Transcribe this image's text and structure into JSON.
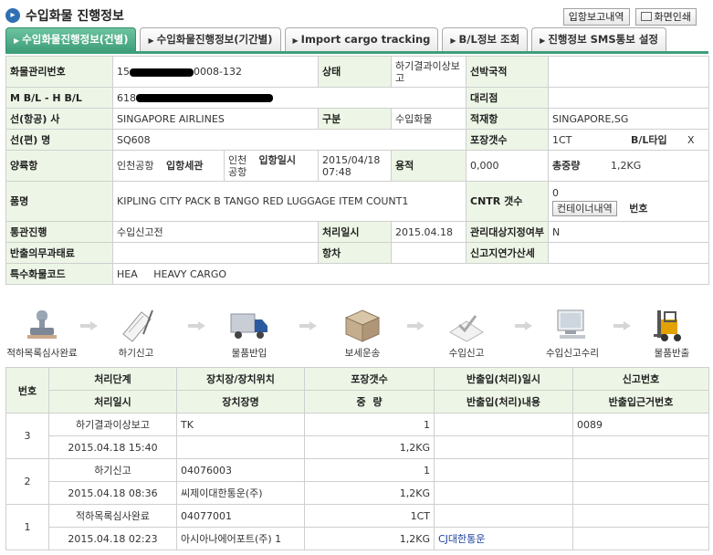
{
  "title": "수입화물 진행정보",
  "top_buttons": {
    "entry_report": "입항보고내역",
    "print": "화면인쇄"
  },
  "tabs": [
    {
      "label": "수입화물진행정보(건별)",
      "active": true
    },
    {
      "label": "수입화물진행정보(기간별)",
      "active": false
    },
    {
      "label": "Import cargo tracking",
      "active": false
    },
    {
      "label": "B/L정보 조회",
      "active": false
    },
    {
      "label": "진행정보 SMS통보 설정",
      "active": false
    }
  ],
  "info": {
    "cargo_mgmt_no_label": "화물관리번호",
    "cargo_mgmt_no_prefix": "15",
    "cargo_mgmt_no_suffix": "0008-132",
    "status_label": "상태",
    "status_value": "하기결과이상보고",
    "vessel_nation_label": "선박국적",
    "vessel_nation_value": "",
    "mbl_hbl_label": "M B/L - H B/L",
    "mbl_hbl_prefix": "618",
    "agent_label": "대리점",
    "agent_value": "",
    "carrier_label": "선(항공) 사",
    "carrier_value": "SINGAPORE AIRLINES",
    "division_label": "구분",
    "division_value": "수입화물",
    "loading_port_label": "적재항",
    "loading_port_value": "SINGAPORE,SG",
    "flight_label": "선(편) 명",
    "flight_value": "SQ608",
    "pkg_count_label": "포장갯수",
    "pkg_count_value": "1CT",
    "bl_type_label": "B/L타입",
    "bl_type_value": "X",
    "unloading_port_label": "양륙항",
    "unloading_port_value": "인천공항",
    "entry_customs_label": "입항세관",
    "entry_customs_value": "인천공항",
    "entry_date_label": "입항일시",
    "entry_date_value": "2015/04/18 07:48",
    "volume_label": "용적",
    "volume_value": "0,000",
    "gross_weight_label": "총중량",
    "gross_weight_value": "1,2KG",
    "item_label": "품명",
    "item_value": "KIPLING CITY PACK B TANGO RED LUGGAGE ITEM COUNT1",
    "cntr_count_label": "CNTR 갯수",
    "cntr_count_value": "0",
    "cntr_detail_button": "컨테이너내역",
    "number_label": "번호",
    "number_value": "",
    "clearance_label": "통관진행",
    "clearance_value": "수입신고전",
    "process_date_label": "처리일시",
    "process_date_value": "2015.04.18",
    "mgmt_designation_label": "관리대상지정여부",
    "mgmt_designation_value": "N",
    "release_duty_label": "반출의무과태료",
    "release_duty_value": "",
    "voyage_label": "항차",
    "voyage_value": "",
    "late_report_label": "신고지연가산세",
    "late_report_value": "",
    "special_code_label": "특수화물코드",
    "special_code_value": "HEA     HEAVY CARGO"
  },
  "flow_steps": [
    {
      "label": "적하목록심사완료",
      "icon": "stamp-icon"
    },
    {
      "label": "하기신고",
      "icon": "document-pen-icon"
    },
    {
      "label": "물품반입",
      "icon": "truck-icon"
    },
    {
      "label": "보세운송",
      "icon": "box-icon"
    },
    {
      "label": "수입신고",
      "icon": "approve-icon"
    },
    {
      "label": "수입신고수리",
      "icon": "computer-icon"
    },
    {
      "label": "물품반출",
      "icon": "forklift-icon"
    }
  ],
  "history": {
    "headers_row1": [
      "번호",
      "처리단계",
      "장치장/장치위치",
      "포장갯수",
      "반출입(처리)일시",
      "신고번호"
    ],
    "headers_row2": [
      "처리일시",
      "장치장명",
      "중  량",
      "반출입(처리)내용",
      "반출입근거번호"
    ],
    "rows": [
      {
        "no": "3",
        "step": "하기결과이상보고",
        "location": "TK",
        "pkg": "1",
        "inout_date": "",
        "report_no": "0089",
        "date": "2015.04.18 15:40",
        "place_name": "",
        "weight": "1,2KG",
        "inout_content": "",
        "basis_no": ""
      },
      {
        "no": "2",
        "step": "하기신고",
        "location": "04076003",
        "pkg": "1",
        "inout_date": "",
        "report_no": "",
        "date": "2015.04.18 08:36",
        "place_name": "씨제이대한통운(주)",
        "weight": "1,2KG",
        "inout_content": "",
        "basis_no": ""
      },
      {
        "no": "1",
        "step": "적하목록심사완료",
        "location": "04077001",
        "pkg": "1CT",
        "inout_date": "",
        "report_no": "",
        "date": "2015.04.18 02:23",
        "place_name": "아시아나에어포트(주) 1",
        "weight": "1,2KG",
        "inout_content": "CJ대한통운",
        "basis_no": ""
      }
    ]
  }
}
